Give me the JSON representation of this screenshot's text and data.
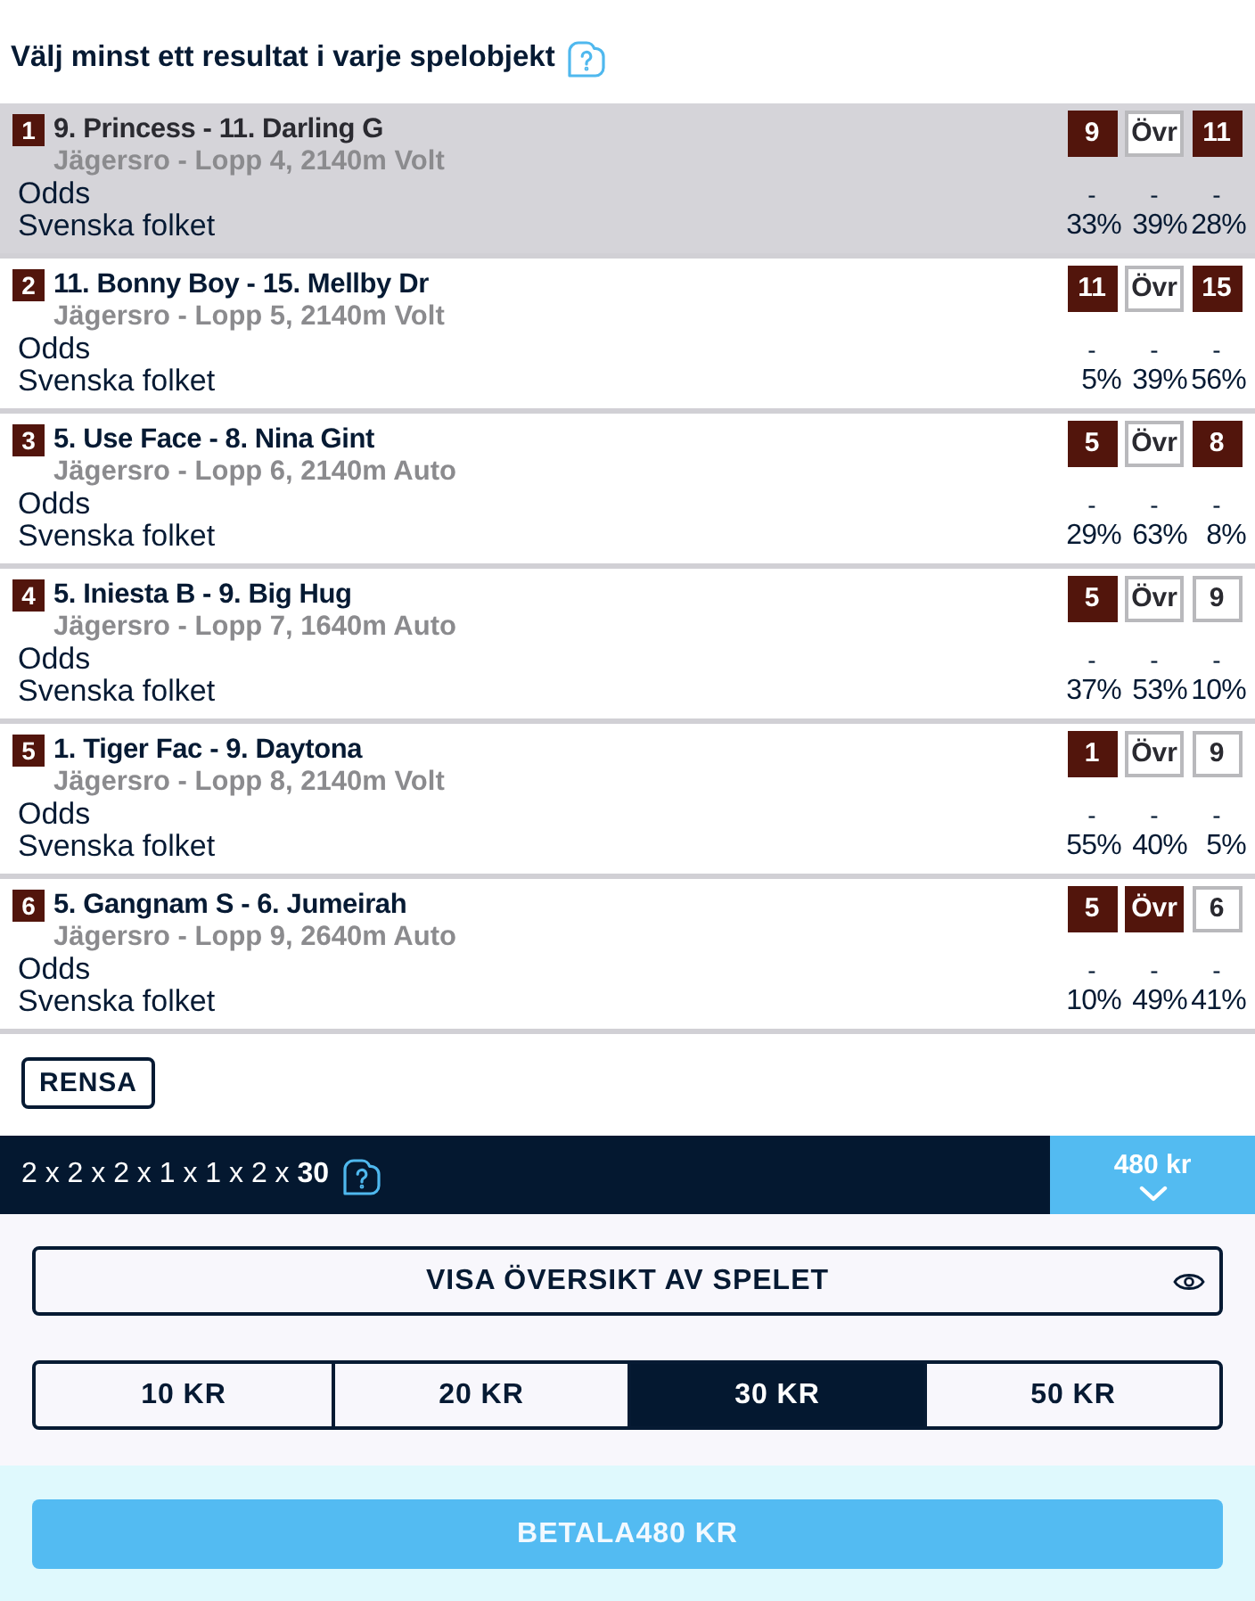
{
  "header": {
    "title": "Välj minst ett resultat i varje spelobjekt"
  },
  "races": [
    {
      "number": "1",
      "title": "9. Princess - 11. Darling G",
      "subtitle": "Jägersro - Lopp 4, 2140m Volt",
      "highlighted": true,
      "odds_label": "Odds",
      "people_label": "Svenska folket",
      "options": [
        {
          "label": "9",
          "selected": true,
          "odds": "-",
          "share": "33%"
        },
        {
          "label": "Övr",
          "selected": false,
          "odds": "-",
          "share": "39%"
        },
        {
          "label": "11",
          "selected": true,
          "odds": "-",
          "share": "28%"
        }
      ]
    },
    {
      "number": "2",
      "title": "11. Bonny Boy - 15. Mellby Dr",
      "subtitle": "Jägersro - Lopp 5, 2140m Volt",
      "highlighted": false,
      "odds_label": "Odds",
      "people_label": "Svenska folket",
      "options": [
        {
          "label": "11",
          "selected": true,
          "odds": "-",
          "share": "5%"
        },
        {
          "label": "Övr",
          "selected": false,
          "odds": "-",
          "share": "39%"
        },
        {
          "label": "15",
          "selected": true,
          "odds": "-",
          "share": "56%"
        }
      ]
    },
    {
      "number": "3",
      "title": "5. Use Face - 8. Nina Gint",
      "subtitle": "Jägersro - Lopp 6, 2140m Auto",
      "highlighted": false,
      "odds_label": "Odds",
      "people_label": "Svenska folket",
      "options": [
        {
          "label": "5",
          "selected": true,
          "odds": "-",
          "share": "29%"
        },
        {
          "label": "Övr",
          "selected": false,
          "odds": "-",
          "share": "63%"
        },
        {
          "label": "8",
          "selected": true,
          "odds": "-",
          "share": "8%"
        }
      ]
    },
    {
      "number": "4",
      "title": "5. Iniesta B - 9. Big Hug",
      "subtitle": "Jägersro - Lopp 7, 1640m Auto",
      "highlighted": false,
      "odds_label": "Odds",
      "people_label": "Svenska folket",
      "options": [
        {
          "label": "5",
          "selected": true,
          "odds": "-",
          "share": "37%"
        },
        {
          "label": "Övr",
          "selected": false,
          "odds": "-",
          "share": "53%"
        },
        {
          "label": "9",
          "selected": false,
          "odds": "-",
          "share": "10%"
        }
      ]
    },
    {
      "number": "5",
      "title": "1. Tiger Fac - 9. Daytona",
      "subtitle": "Jägersro - Lopp 8, 2140m Volt",
      "highlighted": false,
      "odds_label": "Odds",
      "people_label": "Svenska folket",
      "options": [
        {
          "label": "1",
          "selected": true,
          "odds": "-",
          "share": "55%"
        },
        {
          "label": "Övr",
          "selected": false,
          "odds": "-",
          "share": "40%"
        },
        {
          "label": "9",
          "selected": false,
          "odds": "-",
          "share": "5%"
        }
      ]
    },
    {
      "number": "6",
      "title": "5. Gangnam S - 6. Jumeirah",
      "subtitle": "Jägersro - Lopp 9, 2640m Auto",
      "highlighted": false,
      "odds_label": "Odds",
      "people_label": "Svenska folket",
      "options": [
        {
          "label": "5",
          "selected": true,
          "odds": "-",
          "share": "10%"
        },
        {
          "label": "Övr",
          "selected": true,
          "odds": "-",
          "share": "49%"
        },
        {
          "label": "6",
          "selected": false,
          "odds": "-",
          "share": "41%"
        }
      ]
    }
  ],
  "clear_button": "RENSA",
  "summary_bar": {
    "formula": "2 x 2 x 2 x 1 x 1 x 2 x **30**",
    "total": "480 kr"
  },
  "overview_button": "VISA ÖVERSIKT AV SPELET",
  "stakes": [
    {
      "label": "10 KR",
      "selected": false
    },
    {
      "label": "20 KR",
      "selected": false
    },
    {
      "label": "30 KR",
      "selected": true
    },
    {
      "label": "50 KR",
      "selected": false
    }
  ],
  "pay_button": "BETALA480 KR"
}
